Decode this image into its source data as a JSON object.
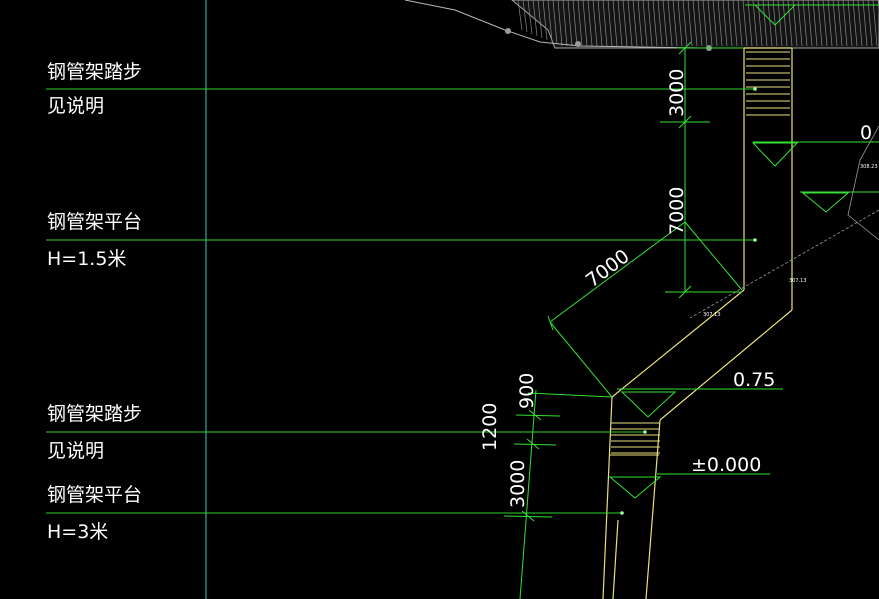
{
  "canvas": {
    "background": "#000000"
  },
  "colors": {
    "leader": "#2bd42b",
    "dimension": "#33e233",
    "stair": "#e9e27c",
    "grid": "#38c7b8",
    "terrain": "#b8b8b8",
    "text": "#ffffff"
  },
  "annotations": {
    "upper_step_title": "钢管架踏步",
    "upper_step_note": "见说明",
    "upper_platform_title": "钢管架平台",
    "upper_platform_height": "H=1.5米",
    "lower_step_title": "钢管架踏步",
    "lower_step_note": "见说明",
    "lower_platform_title": "钢管架平台",
    "lower_platform_height": "H=3米"
  },
  "dimensions": {
    "upper_step_run": "3000",
    "vertical_run": "7000",
    "diagonal_run": "7000",
    "lower_step_a": "900",
    "lower_step_total": "1200",
    "lower_platform_run": "3000"
  },
  "elevations": {
    "mid_landing": "0.75",
    "base": "±0.000",
    "top_right": "0"
  },
  "survey_points": [
    "307.13",
    "307.13",
    "308.23"
  ]
}
